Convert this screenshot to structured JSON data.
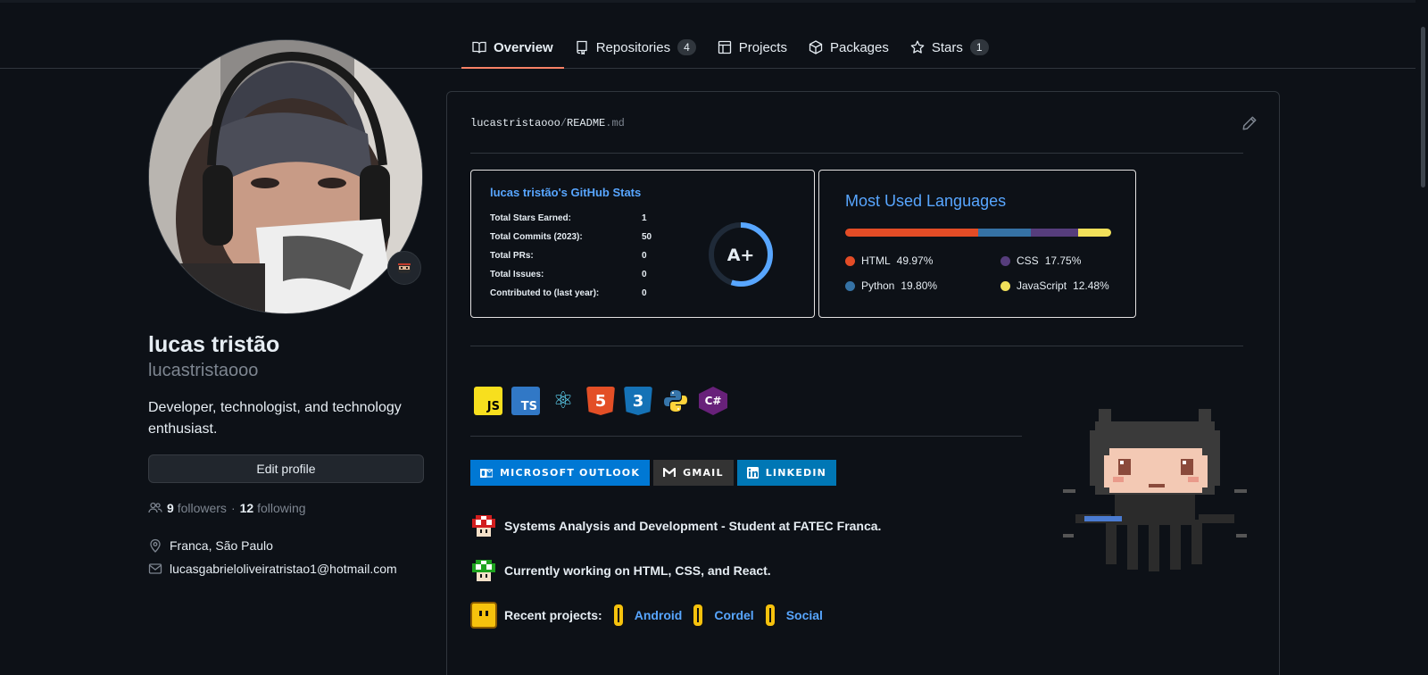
{
  "nav": {
    "tabs": [
      {
        "label": "Overview"
      },
      {
        "label": "Repositories",
        "count": "4"
      },
      {
        "label": "Projects"
      },
      {
        "label": "Packages"
      },
      {
        "label": "Stars",
        "count": "1"
      }
    ]
  },
  "profile": {
    "name": "lucas tristão",
    "username": "lucastristaooo",
    "bio": "Developer, technologist, and technology enthusiast.",
    "edit_label": "Edit profile",
    "followers_count": "9",
    "followers_label": "followers",
    "separator": "·",
    "following_count": "12",
    "following_label": "following",
    "location": "Franca, São Paulo",
    "email": "lucasgabrieloliveiratristao1@hotmail.com"
  },
  "readme": {
    "owner": "lucastristaooo",
    "slash": "/",
    "file": "README",
    "ext": ".md",
    "stats": {
      "title": "lucas tristão's GitHub Stats",
      "rows": [
        {
          "label": "Total Stars Earned:",
          "value": "1"
        },
        {
          "label": "Total Commits (2023):",
          "value": "50"
        },
        {
          "label": "Total PRs:",
          "value": "0"
        },
        {
          "label": "Total Issues:",
          "value": "0"
        },
        {
          "label": "Contributed to (last year):",
          "value": "0"
        }
      ],
      "grade": "A+",
      "grade_progress": 0.55
    },
    "languages": {
      "title": "Most Used Languages",
      "items": [
        {
          "name": "HTML",
          "percent": "49.97%",
          "value": 49.97,
          "color": "#e34c26"
        },
        {
          "name": "CSS",
          "percent": "17.75%",
          "value": 17.75,
          "color": "#563d7c"
        },
        {
          "name": "Python",
          "percent": "19.80%",
          "value": 19.8,
          "color": "#3572a5"
        },
        {
          "name": "JavaScript",
          "percent": "12.48%",
          "value": 12.48,
          "color": "#f1e05a"
        }
      ]
    },
    "tech": [
      {
        "label": "JS",
        "icon": "javascript-icon"
      },
      {
        "label": "TS",
        "icon": "typescript-icon"
      },
      {
        "label": "⚛",
        "icon": "react-icon"
      },
      {
        "label": "5",
        "icon": "html5-icon"
      },
      {
        "label": "3",
        "icon": "css3-icon"
      },
      {
        "label": "",
        "icon": "python-icon"
      },
      {
        "label": "C#",
        "icon": "csharp-icon"
      }
    ],
    "badges": [
      {
        "label": "MICROSOFT OUTLOOK",
        "color": "#0078d4",
        "icon": "outlook-icon"
      },
      {
        "label": "GMAIL",
        "color": "#333333",
        "icon": "gmail-icon"
      },
      {
        "label": "LINKEDIN",
        "color": "#0077b5",
        "icon": "linkedin-icon"
      }
    ],
    "lines": {
      "study": "Systems Analysis and Development - Student at FATEC Franca.",
      "working": "Currently working on HTML, CSS, and React.",
      "recent_label": "Recent projects:",
      "projects": [
        "Android",
        "Cordel",
        "Social"
      ]
    }
  }
}
